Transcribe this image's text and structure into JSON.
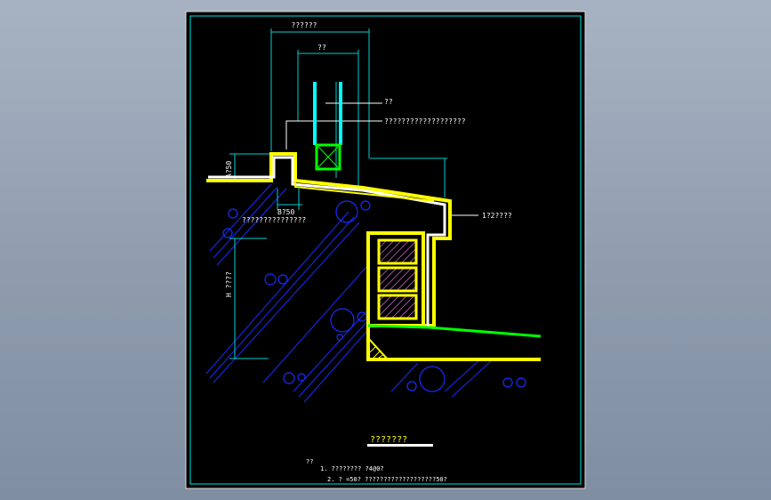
{
  "drawing": {
    "dim_top_overall": "??????",
    "dim_top_inner": "??",
    "leader_label_1": "??",
    "leader_label_2": "???????????????????",
    "dim_left_height_small": "A?50",
    "dim_below_curb": "B?50",
    "note_under_curb": "???????????????",
    "dim_left_height_large": "H ????",
    "leader_label_right": "1?2????",
    "drawing_title": "???????",
    "notes_heading": "??",
    "note_line_1": "1. ????????   ?4@0?",
    "note_line_2": "2.  ?  =50?    ???????????????????50?"
  },
  "colors": {
    "background": "#000000",
    "frame": "#00e5e5",
    "dimension": "#00d0d0",
    "leader": "#ffffff",
    "concrete_outline": "#ffff00",
    "lining": "#ffffff",
    "water_pipe": "#00ffff",
    "valve_box": "#00ff00",
    "ground_line": "#00ff00",
    "hatching": "#0000ff",
    "block_hatch": "#cc66cc",
    "title_text": "#ffff00"
  },
  "icons": {
    "valve": "valve-box-icon",
    "title_underline": "title-underline-bar"
  }
}
